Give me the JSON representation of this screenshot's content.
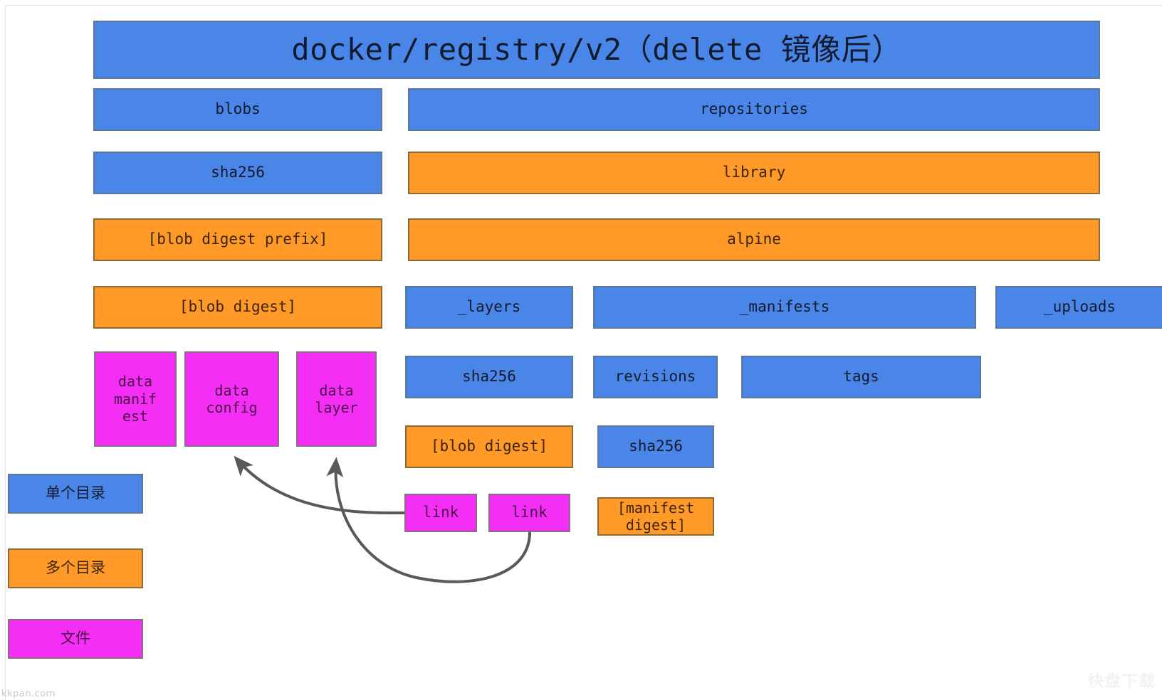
{
  "diagram": {
    "title": "docker/registry/v2（delete 镜像后）",
    "colors": {
      "directory_single": "#4a86e8",
      "directory_multiple": "#ff9a28",
      "file": "#f52ef5",
      "arrow": "#595959",
      "canvas": "#ffffff"
    },
    "nodes": {
      "title": "docker/registry/v2（delete 镜像后）",
      "blobs": "blobs",
      "sha256_blobs": "sha256",
      "blob_digest_prefix": "[blob digest prefix]",
      "blob_digest_left": "[blob digest]",
      "data_manifest": "data\nmanif\nest",
      "data_config": "data\nconfig",
      "data_layer": "data\nlayer",
      "repositories": "repositories",
      "library": "library",
      "alpine": "alpine",
      "layers": "_layers",
      "manifests": "_manifests",
      "uploads": "_uploads",
      "sha256_layers": "sha256",
      "revisions": "revisions",
      "tags": "tags",
      "blob_digest_layers": "[blob digest]",
      "sha256_revisions": "sha256",
      "link_1": "link",
      "link_2": "link",
      "manifest_digest": "[manifest\ndigest]"
    },
    "legend": [
      {
        "label": "单个目录",
        "color": "#4a86e8",
        "kind": "blue"
      },
      {
        "label": "多个目录",
        "color": "#ff9a28",
        "kind": "orange"
      },
      {
        "label": "文件",
        "color": "#f52ef5",
        "kind": "magenta"
      }
    ],
    "watermarks": {
      "bottom_left": "kkpan.com",
      "bottom_right": "快盘下载"
    }
  }
}
